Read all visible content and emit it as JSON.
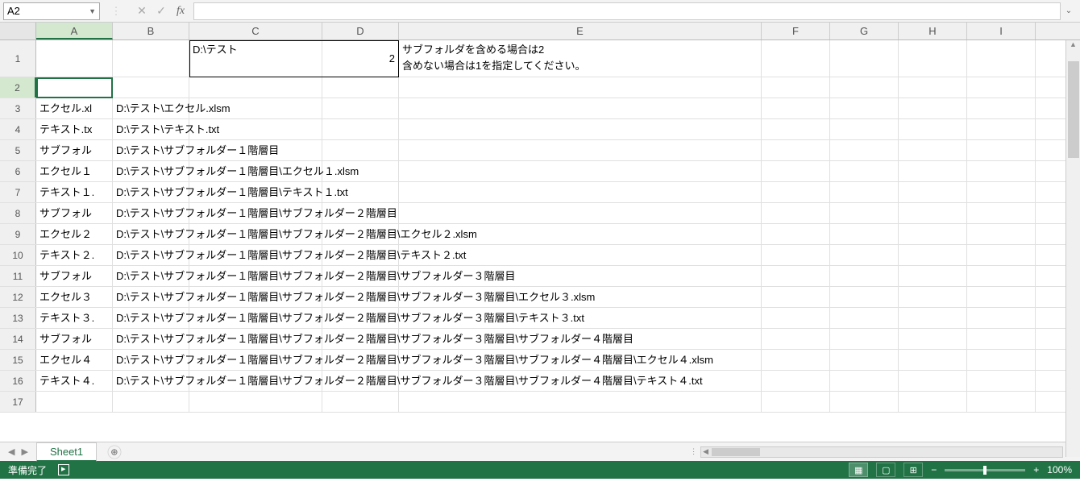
{
  "name_box": "A2",
  "formula": "",
  "columns": [
    "A",
    "B",
    "C",
    "D",
    "E",
    "F",
    "G",
    "H",
    "I"
  ],
  "col_widths": {
    "A": 95,
    "B": 95,
    "C": 165,
    "D": 95,
    "E": 450,
    "F": 85,
    "G": 85,
    "H": 85,
    "I": 85
  },
  "active_cell": {
    "row": 2,
    "col": "A"
  },
  "row1": {
    "C": "D:\\テスト",
    "D": "2",
    "E": "サブフォルダを含める場合は2\n含めない場合は1を指定してください。"
  },
  "data_rows": [
    {
      "r": 3,
      "A": "エクセル.xl",
      "B": "D:\\テスト\\エクセル.xlsm"
    },
    {
      "r": 4,
      "A": "テキスト.tx",
      "B": "D:\\テスト\\テキスト.txt"
    },
    {
      "r": 5,
      "A": "サブフォル",
      "B": "D:\\テスト\\サブフォルダー１階層目"
    },
    {
      "r": 6,
      "A": "エクセル１",
      "B": "D:\\テスト\\サブフォルダー１階層目\\エクセル１.xlsm"
    },
    {
      "r": 7,
      "A": "テキスト１.",
      "B": "D:\\テスト\\サブフォルダー１階層目\\テキスト１.txt"
    },
    {
      "r": 8,
      "A": "サブフォル",
      "B": "D:\\テスト\\サブフォルダー１階層目\\サブフォルダー２階層目"
    },
    {
      "r": 9,
      "A": "エクセル２",
      "B": "D:\\テスト\\サブフォルダー１階層目\\サブフォルダー２階層目\\エクセル２.xlsm"
    },
    {
      "r": 10,
      "A": "テキスト２.",
      "B": "D:\\テスト\\サブフォルダー１階層目\\サブフォルダー２階層目\\テキスト２.txt"
    },
    {
      "r": 11,
      "A": "サブフォル",
      "B": "D:\\テスト\\サブフォルダー１階層目\\サブフォルダー２階層目\\サブフォルダー３階層目"
    },
    {
      "r": 12,
      "A": "エクセル３",
      "B": "D:\\テスト\\サブフォルダー１階層目\\サブフォルダー２階層目\\サブフォルダー３階層目\\エクセル３.xlsm"
    },
    {
      "r": 13,
      "A": "テキスト３.",
      "B": "D:\\テスト\\サブフォルダー１階層目\\サブフォルダー２階層目\\サブフォルダー３階層目\\テキスト３.txt"
    },
    {
      "r": 14,
      "A": "サブフォル",
      "B": "D:\\テスト\\サブフォルダー１階層目\\サブフォルダー２階層目\\サブフォルダー３階層目\\サブフォルダー４階層目"
    },
    {
      "r": 15,
      "A": "エクセル４",
      "B": "D:\\テスト\\サブフォルダー１階層目\\サブフォルダー２階層目\\サブフォルダー３階層目\\サブフォルダー４階層目\\エクセル４.xlsm"
    },
    {
      "r": 16,
      "A": "テキスト４.",
      "B": "D:\\テスト\\サブフォルダー１階層目\\サブフォルダー２階層目\\サブフォルダー３階層目\\サブフォルダー４階層目\\テキスト４.txt"
    }
  ],
  "sheet_tab": "Sheet1",
  "status": {
    "ready": "準備完了",
    "zoom": "100%"
  }
}
